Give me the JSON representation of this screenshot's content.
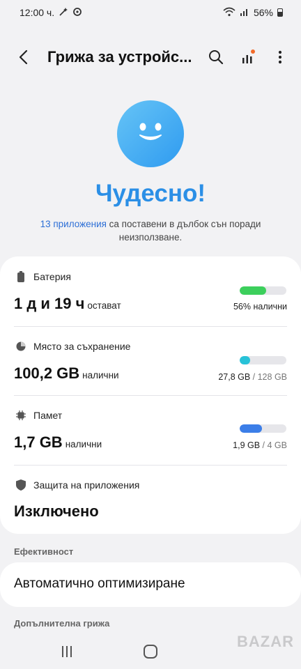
{
  "status_bar": {
    "time": "12:00 ч.",
    "battery": "56%"
  },
  "header": {
    "title": "Грижа за устройс..."
  },
  "hero": {
    "status": "Чудесно!",
    "apps_link": "13 приложения",
    "description_rest": " са поставени в дълбок сън поради неизползване."
  },
  "battery": {
    "label": "Батерия",
    "value": "1 д и 19 ч",
    "suffix": "остават",
    "detail": "56% налични",
    "level_percent": 56,
    "color": "#3ccf5c"
  },
  "storage": {
    "label": "Място за съхранение",
    "value": "100,2 GB",
    "suffix": "налични",
    "used": "27,8 GB",
    "separator": " / ",
    "total": "128 GB",
    "used_fraction": 0.217,
    "color": "#27c2d8"
  },
  "memory": {
    "label": "Памет",
    "value": "1,7 GB",
    "suffix": "налични",
    "used": "1,9 GB",
    "separator": " / ",
    "total": "4 GB",
    "used_fraction": 0.475,
    "color": "#3b7ee8"
  },
  "app_protection": {
    "label": "Защита на приложения",
    "value": "Изключено"
  },
  "efficiency": {
    "header": "Ефективност",
    "auto_optimize": "Автоматично оптимизиране"
  },
  "additional": {
    "header": "Допълнителна грижа"
  },
  "watermark": "BAZAR"
}
